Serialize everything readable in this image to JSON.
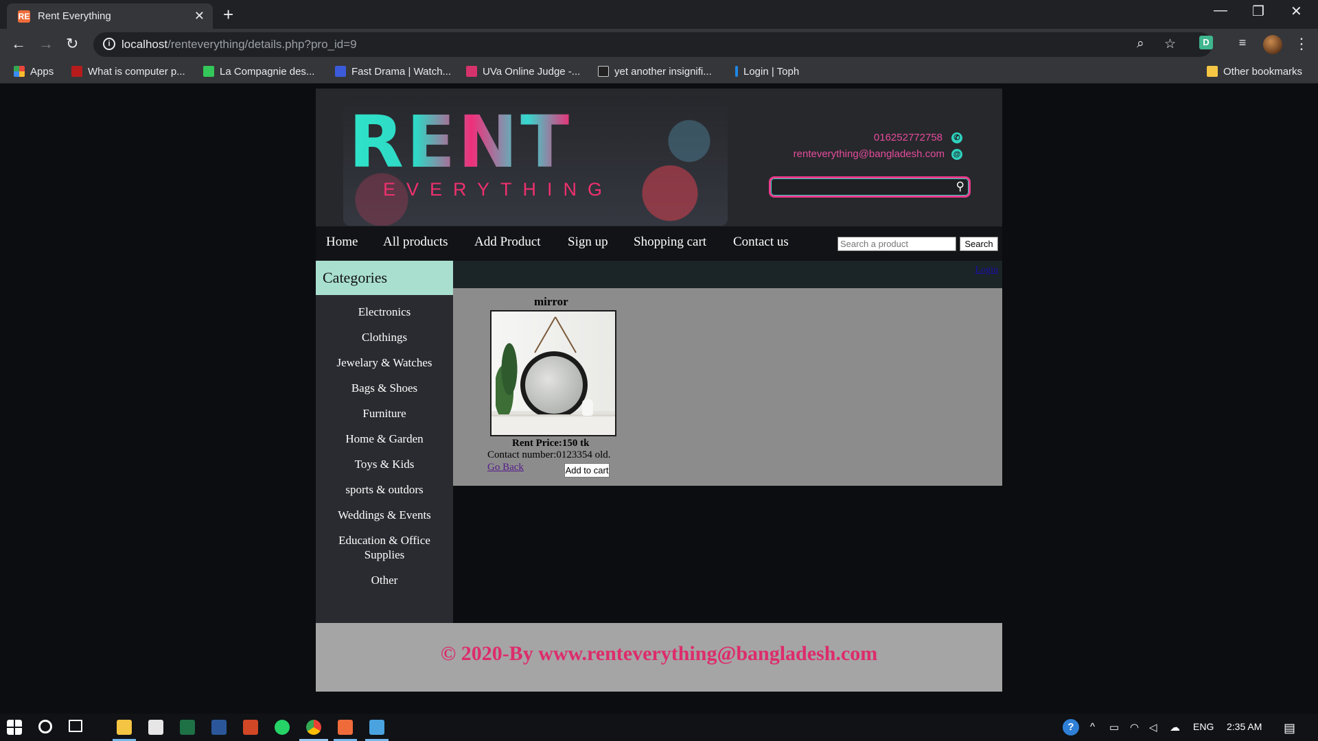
{
  "browser": {
    "tab_title": "Rent Everything",
    "tab_favicon": "RE",
    "url_host": "localhost",
    "url_path": "/renteverything/details.php?pro_id=9",
    "bookmarks": [
      {
        "label": "Apps",
        "icon": "apps-grid-icon",
        "color": "#e8453c"
      },
      {
        "label": "What is computer p...",
        "icon": "site-icon",
        "color": "#b71c1c"
      },
      {
        "label": "La Compagnie des...",
        "icon": "site-icon",
        "color": "#34c759"
      },
      {
        "label": "Fast Drama | Watch...",
        "icon": "site-icon",
        "color": "#3b5bdb"
      },
      {
        "label": "UVa Online Judge -...",
        "icon": "site-icon",
        "color": "#d6336c"
      },
      {
        "label": "yet another insignifi...",
        "icon": "site-icon",
        "color": "#222222"
      },
      {
        "label": "Login | Toph",
        "icon": "site-icon",
        "color": "#1e88e5"
      }
    ],
    "other_bookmarks": "Other bookmarks",
    "extension_label": "D"
  },
  "site": {
    "logo_main": "RENT",
    "logo_sub": "EVERYTHING",
    "phone": "016252772758",
    "email": "renteverything@bangladesh.com",
    "nav": [
      "Home",
      "All products",
      "Add Product",
      "Sign up",
      "Shopping cart",
      "Contact us"
    ],
    "nav_search_placeholder": "Search a product",
    "nav_search_button": "Search",
    "categories_title": "Categories",
    "categories": [
      "Electronics",
      "Clothings",
      "Jewelary & Watches",
      "Bags & Shoes",
      "Furniture",
      "Home & Garden",
      "Toys & Kids",
      "sports & outdors",
      "Weddings & Events",
      "Education & Office Supplies",
      "Other"
    ],
    "login_link": "Login",
    "product": {
      "name": "mirror",
      "price": "Rent Price:150 tk",
      "contact": "Contact number:0123354 old.",
      "go_back": "Go Back",
      "add_to_cart": "Add to cart"
    },
    "footer": "© 2020-By www.renteverything@bangladesh.com"
  },
  "taskbar": {
    "language": "ENG",
    "time": "2:35 AM"
  },
  "colors": {
    "accent_pink": "#dd2c6c",
    "teal": "#2fd8c6",
    "category_header": "#a9dfcf"
  }
}
